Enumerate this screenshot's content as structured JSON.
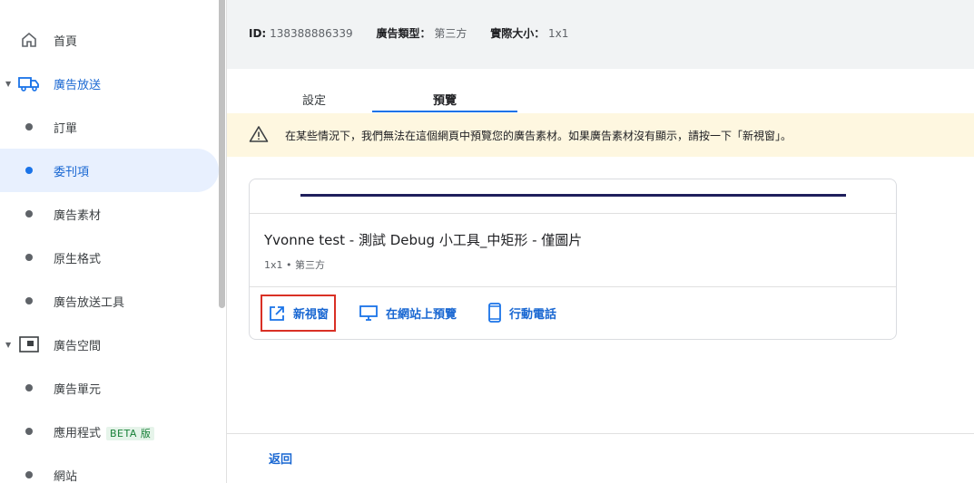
{
  "sidebar": {
    "items": [
      {
        "label": "首頁",
        "icon": "home-icon"
      },
      {
        "label": "廣告放送",
        "icon": "truck-icon"
      },
      {
        "label": "訂單"
      },
      {
        "label": "委刊項"
      },
      {
        "label": "廣告素材"
      },
      {
        "label": "原生格式"
      },
      {
        "label": "廣告放送工具"
      },
      {
        "label": "廣告空間",
        "icon": "inventory-icon"
      },
      {
        "label": "廣告單元"
      },
      {
        "label": "應用程式",
        "badge": "BETA 版"
      },
      {
        "label": "網站"
      }
    ]
  },
  "info": {
    "id_label": "ID:",
    "id_value": "138388886339",
    "type_label": "廣告類型：",
    "type_value": "第三方",
    "size_label": "實際大小：",
    "size_value": "1x1"
  },
  "tabs": [
    {
      "label": "設定"
    },
    {
      "label": "預覽"
    }
  ],
  "warning": {
    "text": "在某些情況下，我們無法在這個網頁中預覽您的廣告素材。如果廣告素材沒有顯示，請按一下「新視窗」。"
  },
  "card": {
    "title": "Yvonne test - 測試 Debug 小工具_中矩形 - 僅圖片",
    "subtitle": "1x1 • 第三方",
    "actions": [
      {
        "label": "新視窗",
        "icon": "open-in-new-icon"
      },
      {
        "label": "在網站上預覽",
        "icon": "desktop-icon"
      },
      {
        "label": "行動電話",
        "icon": "smartphone-icon"
      }
    ]
  },
  "footer": {
    "back_label": "返回"
  },
  "colors": {
    "accent": "#1a73e8",
    "link": "#1967d2",
    "warning_bg": "#fef7e0",
    "highlight_border": "#d93025"
  }
}
